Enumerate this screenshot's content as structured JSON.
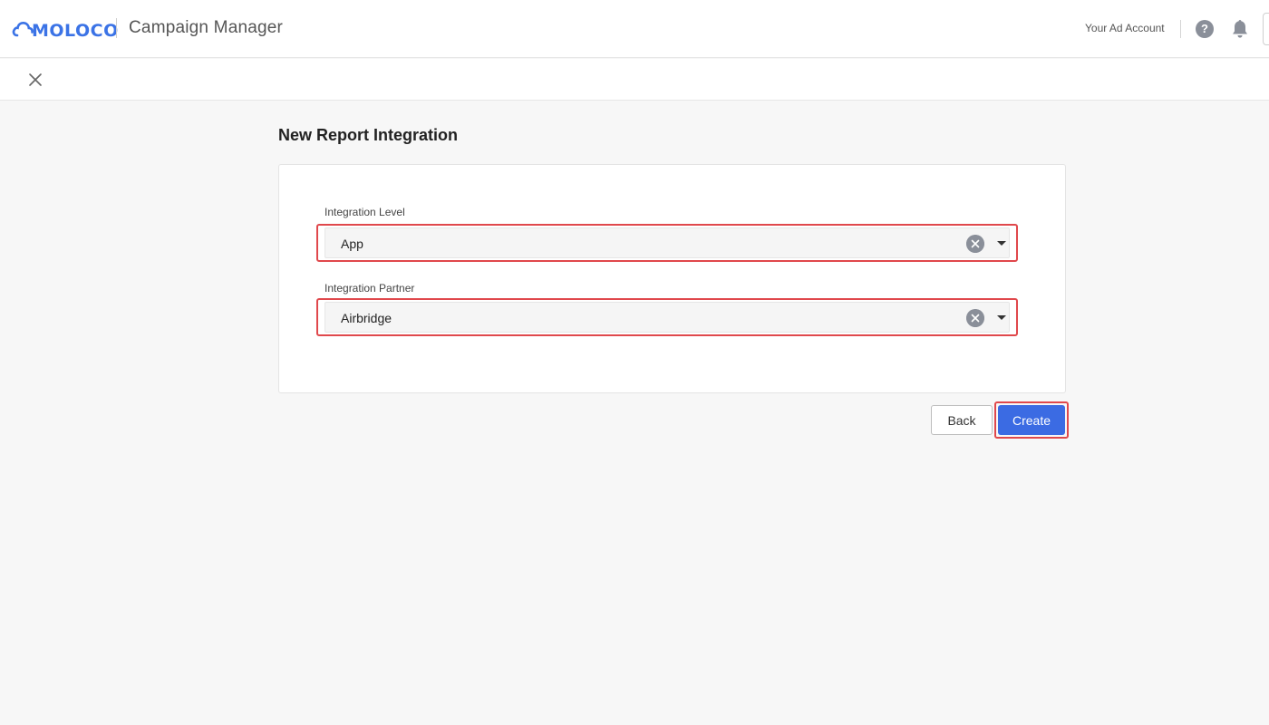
{
  "header": {
    "logo_text": "MOLOCO",
    "app_title": "Campaign Manager",
    "account_label": "Your Ad Account",
    "help_glyph": "?"
  },
  "icons": {
    "logo": "cloud-logo-icon",
    "help": "help-icon",
    "notifications": "bell-icon",
    "close": "close-icon",
    "clear": "clear-icon",
    "dropdown": "caret-down-icon"
  },
  "page": {
    "title": "New Report Integration"
  },
  "form": {
    "integration_level": {
      "label": "Integration Level",
      "value": "App"
    },
    "integration_partner": {
      "label": "Integration Partner",
      "value": "Airbridge"
    }
  },
  "actions": {
    "back_label": "Back",
    "create_label": "Create"
  },
  "colors": {
    "brand": "#3b73e6",
    "primary_button": "#3b6be3",
    "highlight": "#e0484c",
    "background": "#f7f7f7"
  }
}
